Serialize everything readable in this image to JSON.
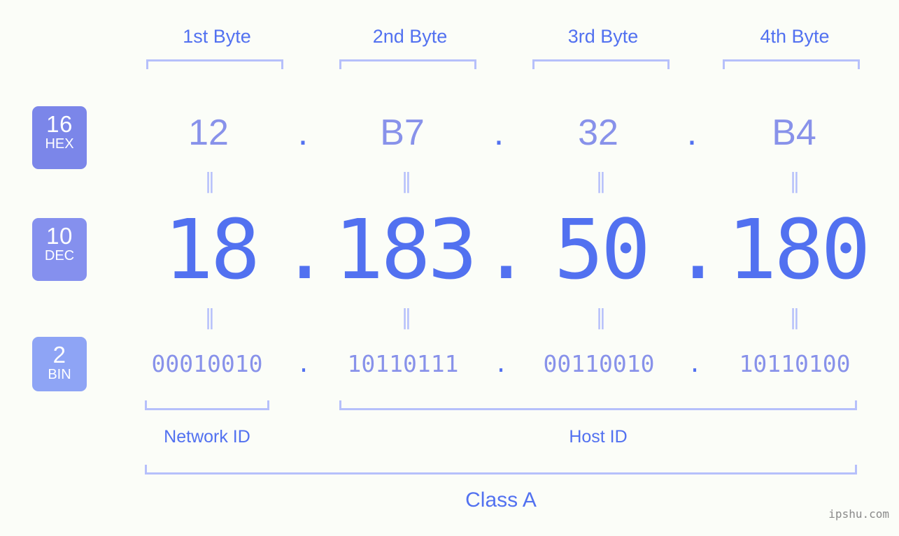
{
  "theme": {
    "background": "#fbfdf8",
    "accent_strong": "#5271f0",
    "accent_light": "#8892ea",
    "bracket": "#b6c0fb",
    "badge_hex": "#7b86e9",
    "badge_dec": "#8590ee",
    "badge_bin": "#8ea4f5",
    "watermark_color": "#8a8a8a"
  },
  "byte_headers": [
    {
      "label": "1st Byte"
    },
    {
      "label": "2nd Byte"
    },
    {
      "label": "3rd Byte"
    },
    {
      "label": "4th Byte"
    }
  ],
  "rows": {
    "hex": {
      "base": "16",
      "abbr": "HEX",
      "values": [
        "12",
        "B7",
        "32",
        "B4"
      ],
      "separator": "."
    },
    "dec": {
      "base": "10",
      "abbr": "DEC",
      "values": [
        "18",
        "183",
        "50",
        "180"
      ],
      "separator": "."
    },
    "bin": {
      "base": "2",
      "abbr": "BIN",
      "values": [
        "00010010",
        "10110111",
        "00110010",
        "10110100"
      ],
      "separator": "."
    }
  },
  "equality_mark": "‖",
  "segments": {
    "network_id": "Network ID",
    "host_id": "Host ID",
    "class": "Class A"
  },
  "watermark": "ipshu.com"
}
